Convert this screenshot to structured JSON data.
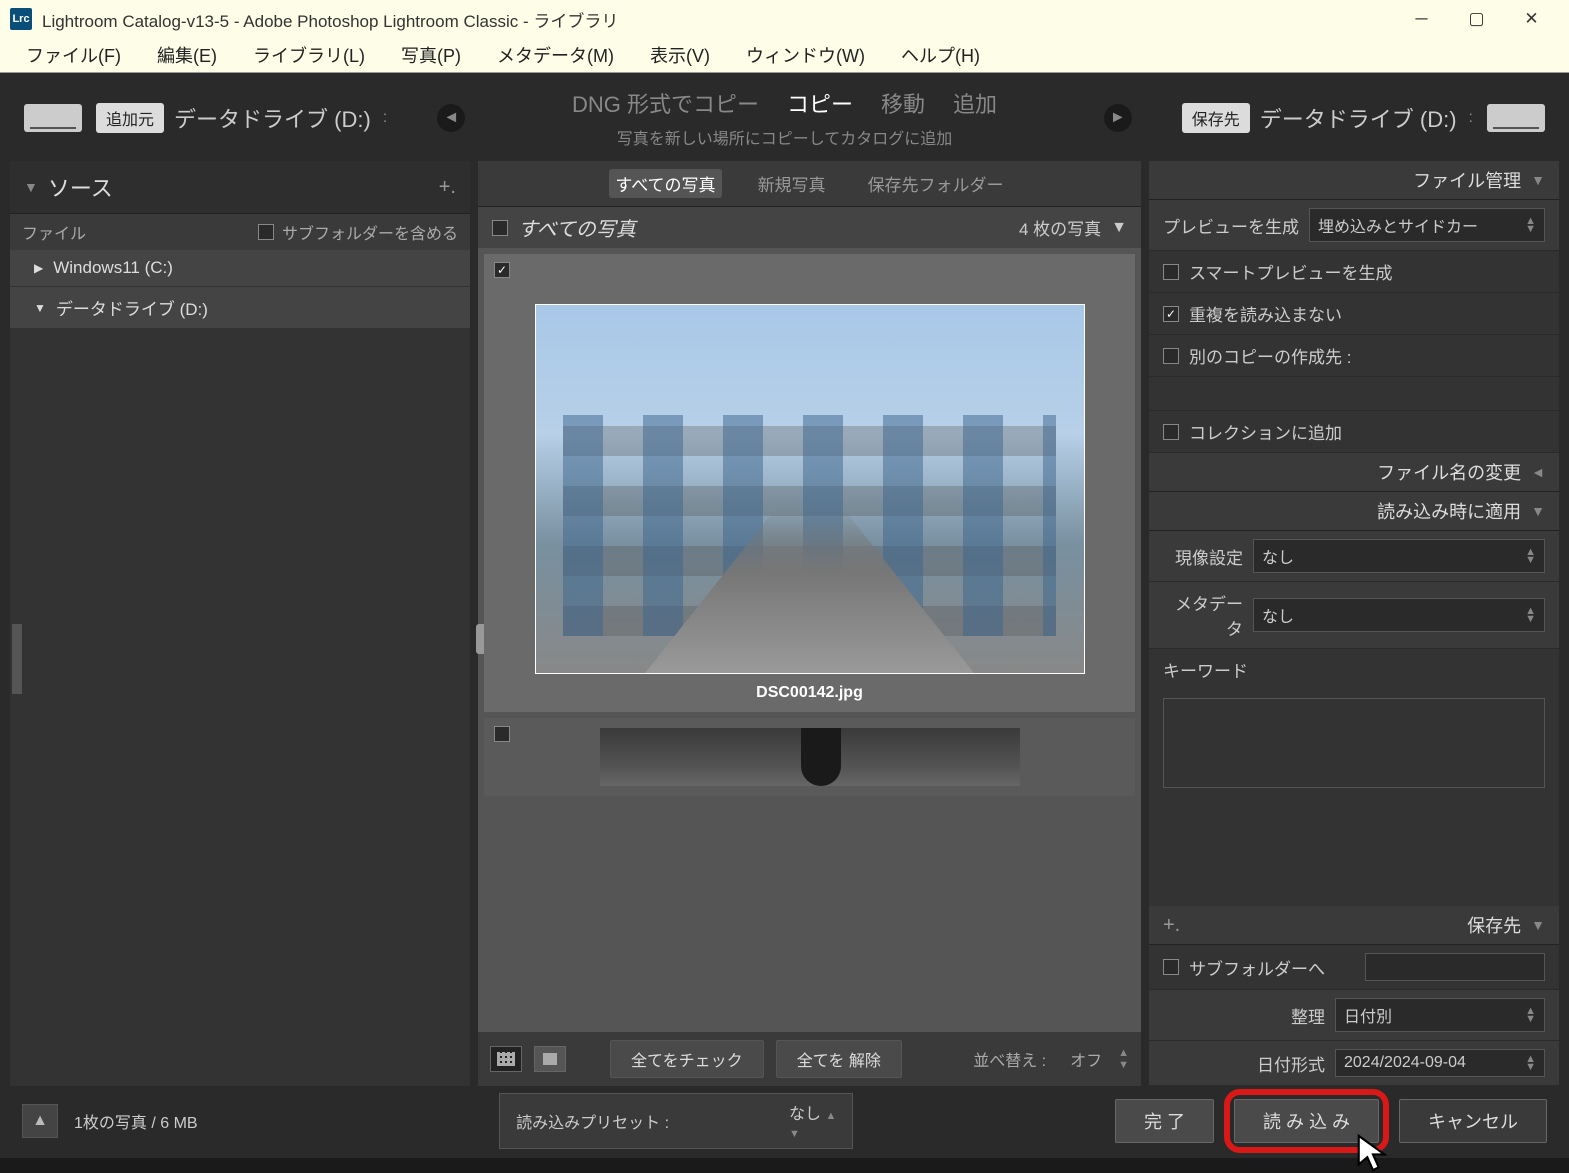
{
  "window": {
    "title": "Lightroom Catalog-v13-5 - Adobe Photoshop Lightroom Classic - ライブラリ",
    "lrc": "Lrc"
  },
  "menu": {
    "file": "ファイル(F)",
    "edit": "編集(E)",
    "library": "ライブラリ(L)",
    "photo": "写真(P)",
    "metadata": "メタデータ(M)",
    "view": "表示(V)",
    "window": "ウィンドウ(W)",
    "help": "ヘルプ(H)"
  },
  "topbar": {
    "from_btn": "追加元",
    "from_drive": "データドライブ (D:)",
    "tabs": {
      "dng": "DNG 形式でコピー",
      "copy": "コピー",
      "move": "移動",
      "add": "追加"
    },
    "subtitle": "写真を新しい場所にコピーしてカタログに追加",
    "to_btn": "保存先",
    "to_drive": "データドライブ (D:)"
  },
  "source": {
    "header": "ソース",
    "file_label": "ファイル",
    "include_sub": "サブフォルダーを含める",
    "items": [
      "Windows11 (C:)",
      "データドライブ (D:)"
    ]
  },
  "center": {
    "tabs": {
      "all": "すべての写真",
      "new": "新規写真",
      "dest": "保存先フォルダー"
    },
    "bar_title": "すべての写真",
    "count": "4 枚の写真",
    "filename": "DSC00142.jpg",
    "footer": {
      "check_all": "全てをチェック",
      "uncheck_all": "全てを 解除",
      "sort_label": "並べ替え :",
      "sort_value": "オフ"
    }
  },
  "right": {
    "file_handling": "ファイル管理",
    "preview_gen_label": "プレビューを生成",
    "preview_gen_value": "埋め込みとサイドカー",
    "smart_preview": "スマートプレビューを生成",
    "no_dupes": "重複を読み込まない",
    "second_copy": "別のコピーの作成先 :",
    "add_collection": "コレクションに追加",
    "file_rename": "ファイル名の変更",
    "apply_import": "読み込み時に適用",
    "develop_label": "現像設定",
    "develop_value": "なし",
    "metadata_label": "メタデータ",
    "metadata_value": "なし",
    "keyword_label": "キーワード",
    "destination": "保存先",
    "subfolder": "サブフォルダーへ",
    "organize_label": "整理",
    "organize_value": "日付別",
    "dateformat_label": "日付形式",
    "dateformat_value": "2024/2024-09-04"
  },
  "bottom": {
    "status": "1枚の写真 / 6 MB",
    "preset_label": "読み込みプリセット :",
    "preset_value": "なし",
    "done": "完 了",
    "import": "読 み 込 み",
    "cancel": "キャンセル"
  }
}
